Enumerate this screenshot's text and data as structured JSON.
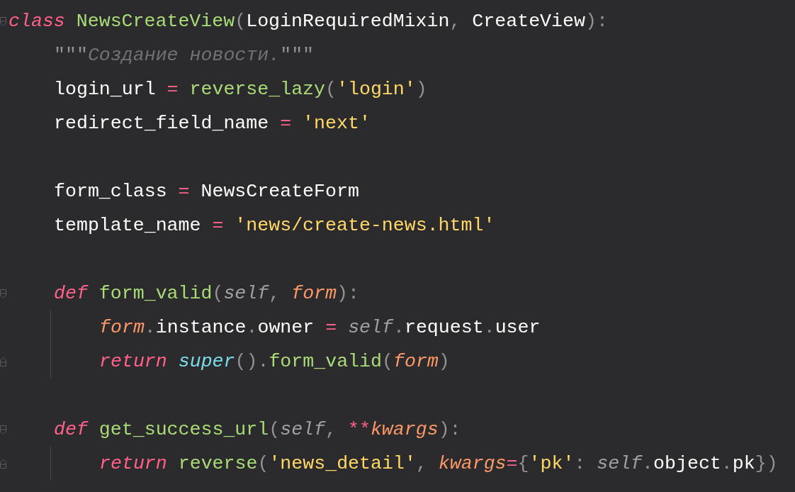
{
  "editor": {
    "lines": [
      {
        "kind": "code",
        "tokens": [
          {
            "t": "class ",
            "kind": "keyword"
          },
          {
            "t": "NewsCreateView",
            "kind": "name"
          },
          {
            "t": "(",
            "kind": "punct"
          },
          {
            "t": "LoginRequiredMixin",
            "kind": "ident"
          },
          {
            "t": ", ",
            "kind": "punct"
          },
          {
            "t": "CreateView",
            "kind": "ident"
          },
          {
            "t": "):",
            "kind": "punct"
          }
        ],
        "children": [
          {
            "kind": "code",
            "tokens": [
              {
                "t": "\"\"\"",
                "kind": "punct"
              },
              {
                "t": "Создание новости.",
                "kind": "doc"
              },
              {
                "t": "\"\"\"",
                "kind": "punct"
              }
            ]
          },
          {
            "kind": "code",
            "tokens": [
              {
                "t": "login_url",
                "kind": "ident"
              },
              {
                "t": " = ",
                "kind": "operator"
              },
              {
                "t": "reverse_lazy",
                "kind": "name"
              },
              {
                "t": "(",
                "kind": "punct"
              },
              {
                "t": "'login'",
                "kind": "string"
              },
              {
                "t": ")",
                "kind": "punct"
              }
            ]
          },
          {
            "kind": "code",
            "tokens": [
              {
                "t": "redirect_field_name",
                "kind": "ident"
              },
              {
                "t": " = ",
                "kind": "operator"
              },
              {
                "t": "'next'",
                "kind": "string"
              }
            ]
          },
          {
            "kind": "blank"
          },
          {
            "kind": "code",
            "tokens": [
              {
                "t": "form_class",
                "kind": "ident"
              },
              {
                "t": " = ",
                "kind": "operator"
              },
              {
                "t": "NewsCreateForm",
                "kind": "ident"
              }
            ]
          },
          {
            "kind": "code",
            "tokens": [
              {
                "t": "template_name",
                "kind": "ident"
              },
              {
                "t": " = ",
                "kind": "operator"
              },
              {
                "t": "'news/create-news.html'",
                "kind": "string"
              }
            ]
          },
          {
            "kind": "blank"
          },
          {
            "kind": "code",
            "tokens": [
              {
                "t": "def ",
                "kind": "keyword"
              },
              {
                "t": "form_valid",
                "kind": "name"
              },
              {
                "t": "(",
                "kind": "punct"
              },
              {
                "t": "self",
                "kind": "self"
              },
              {
                "t": ", ",
                "kind": "punct"
              },
              {
                "t": "form",
                "kind": "param"
              },
              {
                "t": "):",
                "kind": "punct"
              }
            ],
            "children": [
              {
                "kind": "code",
                "tokens": [
                  {
                    "t": "form",
                    "kind": "param"
                  },
                  {
                    "t": ".",
                    "kind": "punct"
                  },
                  {
                    "t": "instance",
                    "kind": "ident"
                  },
                  {
                    "t": ".",
                    "kind": "punct"
                  },
                  {
                    "t": "owner",
                    "kind": "ident"
                  },
                  {
                    "t": " = ",
                    "kind": "operator"
                  },
                  {
                    "t": "self",
                    "kind": "self"
                  },
                  {
                    "t": ".",
                    "kind": "punct"
                  },
                  {
                    "t": "request",
                    "kind": "ident"
                  },
                  {
                    "t": ".",
                    "kind": "punct"
                  },
                  {
                    "t": "user",
                    "kind": "ident"
                  }
                ]
              },
              {
                "kind": "code",
                "tokens": [
                  {
                    "t": "return ",
                    "kind": "keyword"
                  },
                  {
                    "t": "super",
                    "kind": "builtin"
                  },
                  {
                    "t": "().",
                    "kind": "punct"
                  },
                  {
                    "t": "form_valid",
                    "kind": "name"
                  },
                  {
                    "t": "(",
                    "kind": "punct"
                  },
                  {
                    "t": "form",
                    "kind": "param"
                  },
                  {
                    "t": ")",
                    "kind": "punct"
                  }
                ]
              }
            ]
          },
          {
            "kind": "blank"
          },
          {
            "kind": "code",
            "tokens": [
              {
                "t": "def ",
                "kind": "keyword"
              },
              {
                "t": "get_success_url",
                "kind": "name"
              },
              {
                "t": "(",
                "kind": "punct"
              },
              {
                "t": "self",
                "kind": "self"
              },
              {
                "t": ", ",
                "kind": "punct"
              },
              {
                "t": "**",
                "kind": "operator"
              },
              {
                "t": "kwargs",
                "kind": "param"
              },
              {
                "t": "):",
                "kind": "punct"
              }
            ],
            "children": [
              {
                "kind": "code",
                "tokens": [
                  {
                    "t": "return ",
                    "kind": "keyword"
                  },
                  {
                    "t": "reverse",
                    "kind": "name"
                  },
                  {
                    "t": "(",
                    "kind": "punct"
                  },
                  {
                    "t": "'news_detail'",
                    "kind": "string"
                  },
                  {
                    "t": ", ",
                    "kind": "punct"
                  },
                  {
                    "t": "kwargs",
                    "kind": "param"
                  },
                  {
                    "t": "=",
                    "kind": "operator"
                  },
                  {
                    "t": "{",
                    "kind": "punct"
                  },
                  {
                    "t": "'pk'",
                    "kind": "string"
                  },
                  {
                    "t": ": ",
                    "kind": "punct"
                  },
                  {
                    "t": "self",
                    "kind": "self"
                  },
                  {
                    "t": ".",
                    "kind": "punct"
                  },
                  {
                    "t": "object",
                    "kind": "ident"
                  },
                  {
                    "t": ".",
                    "kind": "punct"
                  },
                  {
                    "t": "pk",
                    "kind": "ident"
                  },
                  {
                    "t": "})",
                    "kind": "punct"
                  }
                ]
              }
            ]
          }
        ]
      }
    ]
  }
}
